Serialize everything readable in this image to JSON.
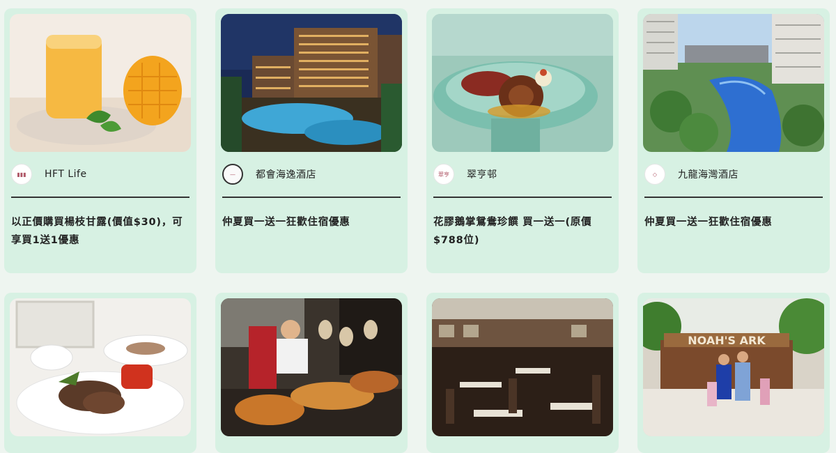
{
  "cards": [
    {
      "merchant": "HFT Life",
      "deal": "以正價購買楊枝甘露(價值$30)，可享買1送1優惠",
      "photo_icon": "mango-dessert-image"
    },
    {
      "merchant": "都會海逸酒店",
      "deal": "仲夏買一送一狂歡住宿優惠",
      "photo_icon": "hotel-pool-night-image"
    },
    {
      "merchant": "翠亨邨",
      "deal": "花膠鵝掌鴛鴦珍饌 買一送一(原價$788位)",
      "photo_icon": "abalone-dish-image"
    },
    {
      "merchant": "九龍海灣酒店",
      "deal": "仲夏買一送一狂歡住宿優惠",
      "photo_icon": "resort-pool-image"
    }
  ],
  "row2": [
    {
      "photo_icon": "lamb-chop-plate-image"
    },
    {
      "photo_icon": "buffet-chef-image"
    },
    {
      "photo_icon": "restaurant-interior-image"
    },
    {
      "photo_icon": "noahs-ark-family-image",
      "sign_text": "NOAH'S ARK"
    }
  ],
  "colors": {
    "card_bg": "#d7f1e3",
    "page_bg": "#eef5f0",
    "text": "#222222"
  }
}
